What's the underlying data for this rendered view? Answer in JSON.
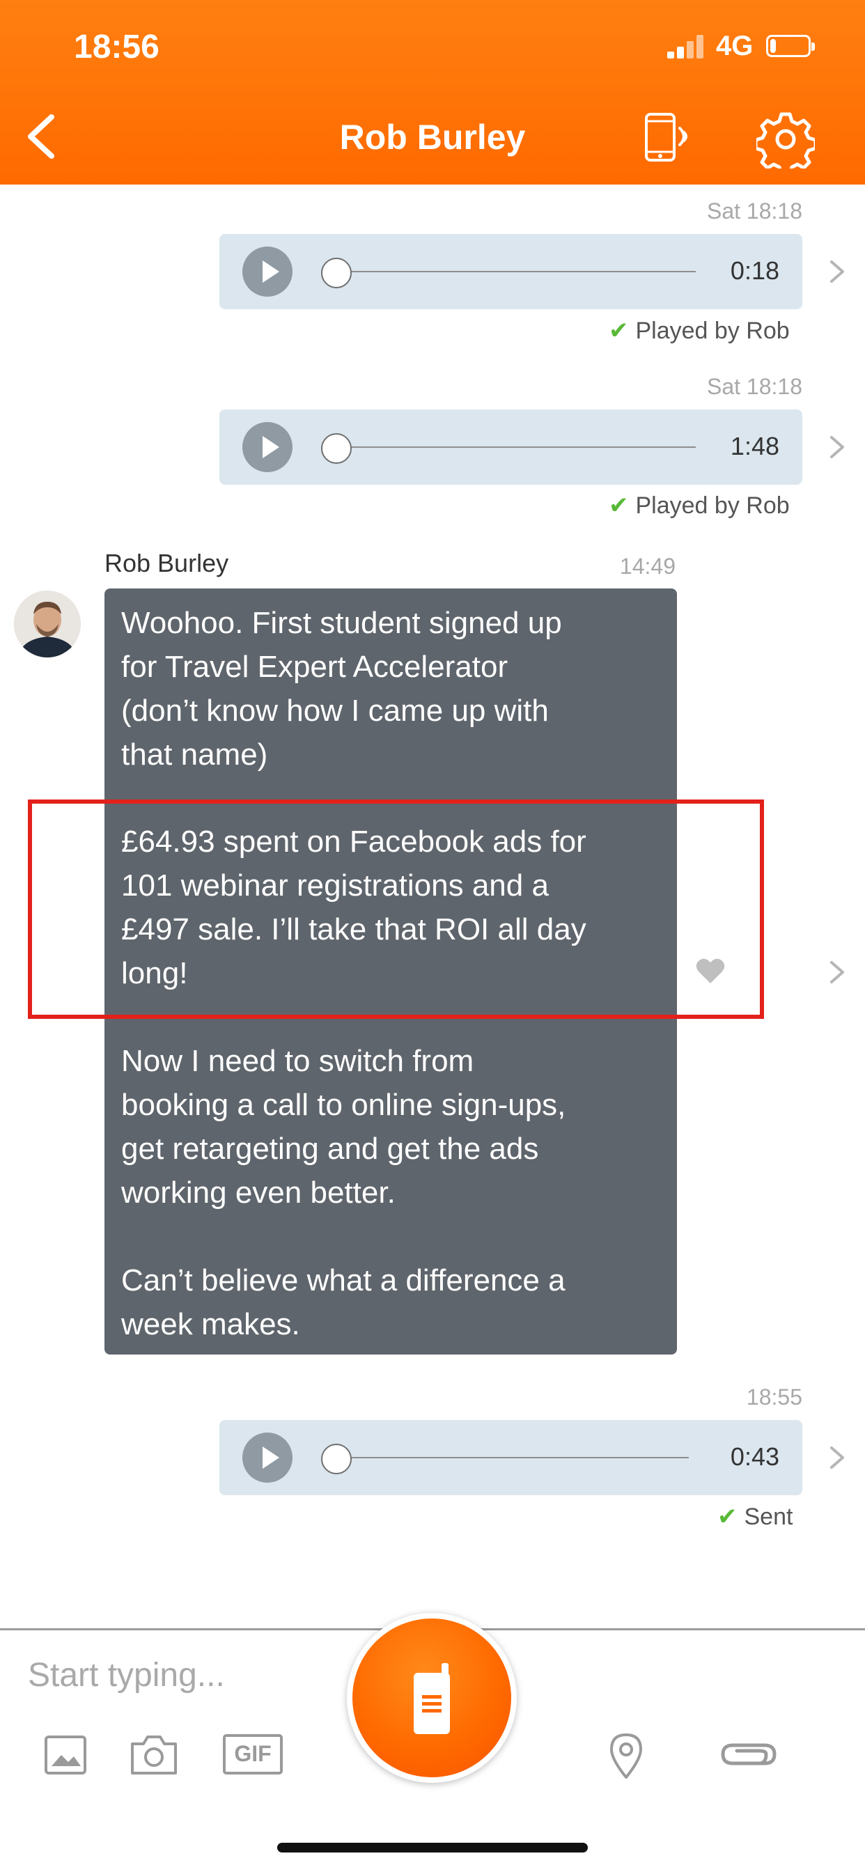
{
  "status_bar": {
    "time": "18:56",
    "network": "4G",
    "battery_level": 0.15
  },
  "header": {
    "title": "Rob Burley"
  },
  "messages": {
    "voice1": {
      "timestamp": "Sat 18:18",
      "duration": "0:18",
      "status": "Played by Rob"
    },
    "voice2": {
      "timestamp": "Sat 18:18",
      "duration": "1:48",
      "status": "Played by Rob"
    },
    "text": {
      "sender": "Rob Burley",
      "timestamp": "14:49",
      "lines": [
        "Woohoo. First student signed up",
        "for Travel Expert Accelerator",
        "(don’t know how I came up with",
        "that name)",
        "£64.93 spent on Facebook ads for",
        "101 webinar registrations and a",
        "£497 sale. I’ll take that ROI all day",
        "long!",
        "Now I need to switch from",
        "booking a call to online sign-ups,",
        "get retargeting and get the ads",
        "working even better.",
        "Can’t believe what a difference a",
        "week makes."
      ]
    },
    "voice3": {
      "timestamp": "18:55",
      "duration": "0:43",
      "status": "Sent"
    }
  },
  "composer": {
    "placeholder": "Start typing...",
    "gif_label": "GIF"
  },
  "icons": [
    "chevron-left-icon",
    "phone-broadcast-icon",
    "gear-icon",
    "play-icon",
    "chevron-right-icon",
    "check-icon",
    "heart-icon",
    "image-icon",
    "camera-icon",
    "gif-icon",
    "walkie-talkie-icon",
    "location-pin-icon",
    "paperclip-icon"
  ],
  "colors": {
    "brand": "#ff6a00",
    "bubble_incoming": "#5f656c",
    "bubble_voice": "#dbe6ee",
    "check": "#58b937",
    "highlight": "#e3211b"
  }
}
